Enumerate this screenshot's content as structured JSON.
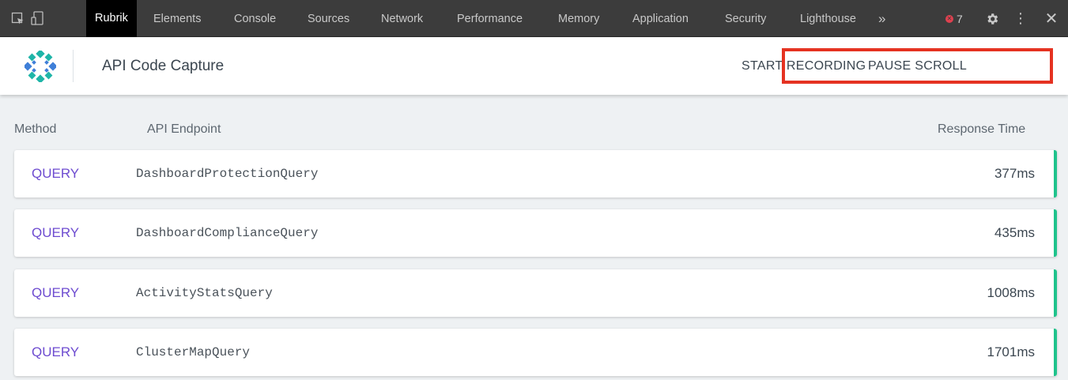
{
  "devtools": {
    "tabs": [
      {
        "label": "Rubrik",
        "active": true
      },
      {
        "label": "Elements"
      },
      {
        "label": "Console"
      },
      {
        "label": "Sources"
      },
      {
        "label": "Network"
      },
      {
        "label": "Performance"
      },
      {
        "label": "Memory"
      },
      {
        "label": "Application"
      },
      {
        "label": "Security"
      },
      {
        "label": "Lighthouse"
      }
    ],
    "more_icon": "chevron-double-right-icon",
    "more_label": "»",
    "error_count": "7",
    "icons": [
      "inspect-element-icon",
      "device-toggle-icon",
      "error-icon",
      "gear-icon",
      "kebab-menu-icon",
      "close-icon"
    ]
  },
  "header": {
    "title": "API Code Capture",
    "start_label": "START RECORDING",
    "pause_label": "PAUSE SCROLL",
    "highlight_color": "#e53221"
  },
  "table": {
    "columns": [
      "Method",
      "API Endpoint",
      "Response Time"
    ],
    "rows": [
      {
        "method": "QUERY",
        "endpoint": "DashboardProtectionQuery",
        "time": "377ms"
      },
      {
        "method": "QUERY",
        "endpoint": "DashboardComplianceQuery",
        "time": "435ms"
      },
      {
        "method": "QUERY",
        "endpoint": "ActivityStatsQuery",
        "time": "1008ms"
      },
      {
        "method": "QUERY",
        "endpoint": "ClusterMapQuery",
        "time": "1701ms"
      }
    ]
  },
  "colors": {
    "method": "#6d4bd0",
    "status_bar": "#1fc38c",
    "logo_teal": "#1fb5a8",
    "logo_blue": "#3f7fd8"
  }
}
